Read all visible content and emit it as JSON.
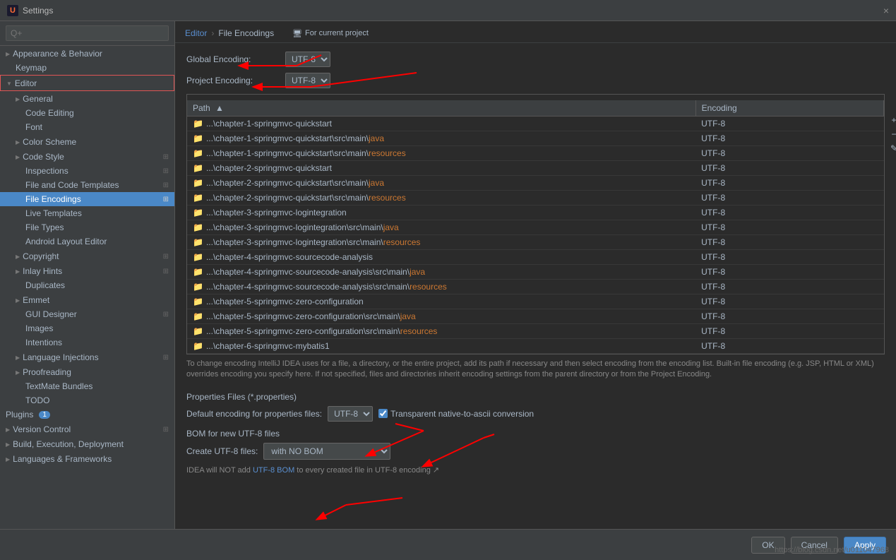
{
  "titleBar": {
    "icon": "U",
    "title": "Settings",
    "closeLabel": "×"
  },
  "breadcrumb": {
    "editor": "Editor",
    "separator": "›",
    "current": "File Encodings",
    "projectLink": "For current project"
  },
  "sidebar": {
    "searchPlaceholder": "Q+",
    "items": [
      {
        "id": "appearance",
        "label": "Appearance & Behavior",
        "level": 0,
        "type": "group",
        "expanded": false
      },
      {
        "id": "keymap",
        "label": "Keymap",
        "level": 0,
        "type": "item"
      },
      {
        "id": "editor",
        "label": "Editor",
        "level": 0,
        "type": "group",
        "expanded": true,
        "outlined": true
      },
      {
        "id": "general",
        "label": "General",
        "level": 1,
        "type": "group",
        "expanded": false
      },
      {
        "id": "code-editing",
        "label": "Code Editing",
        "level": 1,
        "type": "item"
      },
      {
        "id": "font",
        "label": "Font",
        "level": 1,
        "type": "item"
      },
      {
        "id": "color-scheme",
        "label": "Color Scheme",
        "level": 1,
        "type": "group",
        "expanded": false
      },
      {
        "id": "code-style",
        "label": "Code Style",
        "level": 1,
        "type": "group",
        "expanded": false,
        "hasCopy": true
      },
      {
        "id": "inspections",
        "label": "Inspections",
        "level": 1,
        "type": "item",
        "hasCopy": true
      },
      {
        "id": "file-code-templates",
        "label": "File and Code Templates",
        "level": 1,
        "type": "item",
        "hasCopy": true
      },
      {
        "id": "file-encodings",
        "label": "File Encodings",
        "level": 1,
        "type": "item",
        "active": true,
        "hasCopy": true
      },
      {
        "id": "live-templates",
        "label": "Live Templates",
        "level": 1,
        "type": "item"
      },
      {
        "id": "file-types",
        "label": "File Types",
        "level": 1,
        "type": "item"
      },
      {
        "id": "android-layout",
        "label": "Android Layout Editor",
        "level": 1,
        "type": "item"
      },
      {
        "id": "copyright",
        "label": "Copyright",
        "level": 1,
        "type": "group",
        "expanded": false,
        "hasCopy": true
      },
      {
        "id": "inlay-hints",
        "label": "Inlay Hints",
        "level": 1,
        "type": "group",
        "expanded": false,
        "hasCopy": true
      },
      {
        "id": "duplicates",
        "label": "Duplicates",
        "level": 1,
        "type": "item"
      },
      {
        "id": "emmet",
        "label": "Emmet",
        "level": 1,
        "type": "group",
        "expanded": false
      },
      {
        "id": "gui-designer",
        "label": "GUI Designer",
        "level": 1,
        "type": "item",
        "hasCopy": true
      },
      {
        "id": "images",
        "label": "Images",
        "level": 1,
        "type": "item"
      },
      {
        "id": "intentions",
        "label": "Intentions",
        "level": 1,
        "type": "item"
      },
      {
        "id": "language-injections",
        "label": "Language Injections",
        "level": 1,
        "type": "group",
        "expanded": false,
        "hasCopy": true
      },
      {
        "id": "proofreading",
        "label": "Proofreading",
        "level": 1,
        "type": "group",
        "expanded": false
      },
      {
        "id": "textmate",
        "label": "TextMate Bundles",
        "level": 1,
        "type": "item"
      },
      {
        "id": "todo",
        "label": "TODO",
        "level": 1,
        "type": "item"
      },
      {
        "id": "plugins",
        "label": "Plugins",
        "level": 0,
        "type": "item",
        "badge": "1"
      },
      {
        "id": "version-control",
        "label": "Version Control",
        "level": 0,
        "type": "group",
        "expanded": false,
        "hasCopy": true
      },
      {
        "id": "build",
        "label": "Build, Execution, Deployment",
        "level": 0,
        "type": "group",
        "expanded": false
      },
      {
        "id": "languages",
        "label": "Languages & Frameworks",
        "level": 0,
        "type": "group",
        "expanded": false
      }
    ]
  },
  "encodings": {
    "globalLabel": "Global Encoding:",
    "globalValue": "UTF-8",
    "projectLabel": "Project Encoding:",
    "projectValue": "UTF-8"
  },
  "table": {
    "columns": [
      {
        "id": "path",
        "label": "Path",
        "width": "70%"
      },
      {
        "id": "encoding",
        "label": "Encoding",
        "width": "30%"
      }
    ],
    "rows": [
      {
        "path": "...\\chapter-1-springmvc-quickstart",
        "pathBold": "",
        "encoding": "UTF-8"
      },
      {
        "path": "...\\chapter-1-springmvc-quickstart\\src\\main\\",
        "pathBold": "java",
        "encoding": "UTF-8"
      },
      {
        "path": "...\\chapter-1-springmvc-quickstart\\src\\main\\",
        "pathBold": "resources",
        "encoding": "UTF-8"
      },
      {
        "path": "...\\chapter-2-springmvc-quickstart",
        "pathBold": "",
        "encoding": "UTF-8"
      },
      {
        "path": "...\\chapter-2-springmvc-quickstart\\src\\main\\",
        "pathBold": "java",
        "encoding": "UTF-8"
      },
      {
        "path": "...\\chapter-2-springmvc-quickstart\\src\\main\\",
        "pathBold": "resources",
        "encoding": "UTF-8"
      },
      {
        "path": "...\\chapter-3-springmvc-logintegration",
        "pathBold": "",
        "encoding": "UTF-8"
      },
      {
        "path": "...\\chapter-3-springmvc-logintegration\\src\\main\\",
        "pathBold": "java",
        "encoding": "UTF-8"
      },
      {
        "path": "...\\chapter-3-springmvc-logintegration\\src\\main\\",
        "pathBold": "resources",
        "encoding": "UTF-8"
      },
      {
        "path": "...\\chapter-4-springmvc-sourcecode-analysis",
        "pathBold": "",
        "encoding": "UTF-8"
      },
      {
        "path": "...\\chapter-4-springmvc-sourcecode-analysis\\src\\main\\",
        "pathBold": "java",
        "encoding": "UTF-8"
      },
      {
        "path": "...\\chapter-4-springmvc-sourcecode-analysis\\src\\main\\",
        "pathBold": "resources",
        "encoding": "UTF-8"
      },
      {
        "path": "...\\chapter-5-springmvc-zero-configuration",
        "pathBold": "",
        "encoding": "UTF-8"
      },
      {
        "path": "...\\chapter-5-springmvc-zero-configuration\\src\\main\\",
        "pathBold": "java",
        "encoding": "UTF-8"
      },
      {
        "path": "...\\chapter-5-springmvc-zero-configuration\\src\\main\\",
        "pathBold": "resources",
        "encoding": "UTF-8"
      },
      {
        "path": "...\\chapter-6-springmvc-mybatis1",
        "pathBold": "",
        "encoding": "UTF-8"
      }
    ]
  },
  "infoText": "To change encoding IntelliJ IDEA uses for a file, a directory, or the entire project, add its path if necessary and then select encoding from the encoding list. Built-in file encoding (e.g. JSP, HTML or XML) overrides encoding you specify here. If not specified, files and directories inherit encoding settings from the parent directory or from the Project Encoding.",
  "properties": {
    "sectionTitle": "Properties Files (*.properties)",
    "defaultEncodingLabel": "Default encoding for properties files:",
    "defaultEncodingValue": "UTF-8",
    "transparentLabel": "Transparent native-to-ascii conversion",
    "transparentChecked": true
  },
  "bom": {
    "sectionTitle": "BOM for new UTF-8 files",
    "createLabel": "Create UTF-8 files:",
    "createValue": "with NO BOM",
    "infoText": "IDEA will NOT add UTF-8 BOM to every created file in UTF-8 encoding ↗",
    "infoLink": "UTF-8 BOM"
  },
  "bottomBar": {
    "okLabel": "OK",
    "cancelLabel": "Cancel",
    "applyLabel": "Apply"
  },
  "url": "https://blog.csdn.net/u011047968"
}
